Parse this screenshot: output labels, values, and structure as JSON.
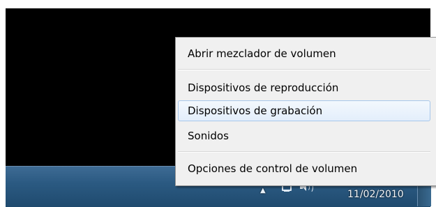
{
  "context_menu": {
    "items": [
      {
        "label": "Abrir mezclador de volumen"
      },
      {
        "label": "Dispositivos de reproducción"
      },
      {
        "label": "Dispositivos de grabación"
      },
      {
        "label": "Sonidos"
      },
      {
        "label": "Opciones de control de volumen"
      }
    ]
  },
  "taskbar": {
    "clock_date": "11/02/2010",
    "tray_icons": [
      "show-hidden-icons-arrow",
      "network-icon",
      "speaker-volume-icon"
    ]
  },
  "colors": {
    "taskbar": "#2b5a82",
    "menu_background": "#f0f0f0",
    "menu_hover": "#e3eefb",
    "hover_border": "#a7c7ea",
    "screen": "#000000"
  }
}
